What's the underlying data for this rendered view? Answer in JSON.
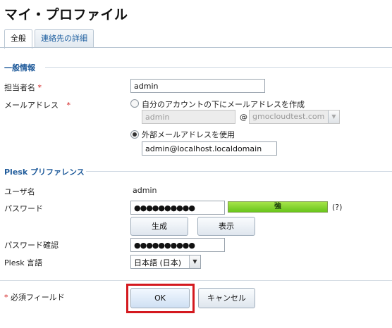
{
  "page": {
    "title": "マイ・プロファイル"
  },
  "tabs": [
    {
      "label": "全般",
      "active": true
    },
    {
      "label": "連絡先の詳細",
      "active": false
    }
  ],
  "general": {
    "heading": "一般情報",
    "contact_name": {
      "label": "担当者名",
      "required_mark": "*",
      "value": "admin"
    },
    "email": {
      "label": "メールアドレス",
      "required_mark": "*",
      "option_create": {
        "label": "自分のアカウントの下にメールアドレスを作成",
        "selected": false
      },
      "local_part": "admin",
      "at_sign": "@",
      "domain": "gmocloudtest.com",
      "option_external": {
        "label": "外部メールアドレスを使用",
        "selected": true
      },
      "external_value": "admin@localhost.localdomain"
    }
  },
  "plesk": {
    "heading": "Plesk プリファレンス",
    "username": {
      "label": "ユーザ名",
      "value": "admin"
    },
    "password": {
      "label": "パスワード",
      "value": "●●●●●●●●●●",
      "strength_label": "強",
      "strength_level": 1.0,
      "help": "(?)",
      "generate_label": "生成",
      "show_label": "表示"
    },
    "password_confirm": {
      "label": "パスワード確認",
      "value": "●●●●●●●●●●"
    },
    "language": {
      "label": "Plesk 言語",
      "value": "日本語 (日本)"
    }
  },
  "footer": {
    "required_mark": "*",
    "required_note": "必須フィールド",
    "ok_label": "OK",
    "cancel_label": "キャンセル"
  },
  "colors": {
    "heading": "#1e5a9a",
    "required": "#d21f1f",
    "highlight": "#d4191f",
    "strength": "#69c51b"
  }
}
